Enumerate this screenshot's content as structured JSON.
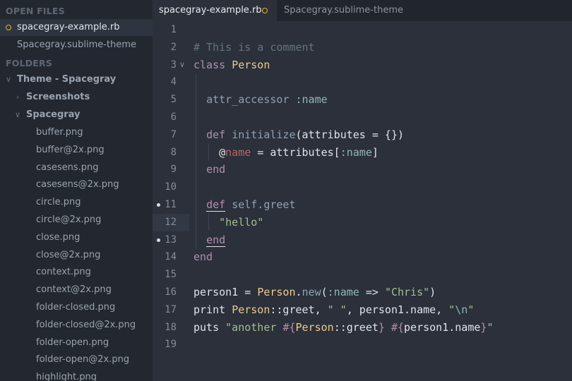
{
  "sidebar": {
    "open_files_header": "OPEN FILES",
    "folders_header": "FOLDERS",
    "open_files": [
      {
        "name": "spacegray-example.rb",
        "modified": true
      },
      {
        "name": "Spacegray.sublime-theme",
        "modified": false
      }
    ],
    "tree": {
      "root": "Theme - Spacegray",
      "screenshots": "Screenshots",
      "spacegray": "Spacegray",
      "files": [
        "buffer.png",
        "buffer@2x.png",
        "casesens.png",
        "casesens@2x.png",
        "circle.png",
        "circle@2x.png",
        "close.png",
        "close@2x.png",
        "context.png",
        "context@2x.png",
        "folder-closed.png",
        "folder-closed@2x.png",
        "folder-open.png",
        "folder-open@2x.png",
        "highlight.png"
      ]
    }
  },
  "tabs": [
    {
      "label": "spacegray-example.rb",
      "active": true,
      "modified": true
    },
    {
      "label": "Spacegray.sublime-theme",
      "active": false,
      "modified": false
    }
  ],
  "editor": {
    "current_line": 12,
    "dirty_lines": [
      11,
      13
    ],
    "fold_line": 3,
    "lines": [
      [],
      [
        [
          "c-comment",
          "# This is a comment"
        ]
      ],
      [
        [
          "c-kw",
          "class"
        ],
        [
          "c-plain",
          " "
        ],
        [
          "c-class",
          "Person"
        ]
      ],
      [],
      [
        [
          "c-plain",
          "  "
        ],
        [
          "c-fn",
          "attr_accessor"
        ],
        [
          "c-plain",
          " "
        ],
        [
          "c-sym",
          ":name"
        ]
      ],
      [],
      [
        [
          "c-plain",
          "  "
        ],
        [
          "c-kw",
          "def"
        ],
        [
          "c-plain",
          " "
        ],
        [
          "c-fn",
          "initialize"
        ],
        [
          "c-plain",
          "(attributes = {})"
        ]
      ],
      [
        [
          "c-plain",
          "    @"
        ],
        [
          "c-ivar",
          "name"
        ],
        [
          "c-plain",
          " = attributes["
        ],
        [
          "c-sym",
          ":name"
        ],
        [
          "c-plain",
          "]"
        ]
      ],
      [
        [
          "c-plain",
          "  "
        ],
        [
          "c-kw",
          "end"
        ]
      ],
      [],
      [
        [
          "c-plain",
          "  "
        ],
        [
          "c-kw uline",
          "def"
        ],
        [
          "c-plain",
          " "
        ],
        [
          "c-fn",
          "self.greet"
        ]
      ],
      [
        [
          "c-plain",
          "    "
        ],
        [
          "c-str",
          "\"hello\""
        ]
      ],
      [
        [
          "c-plain",
          "  "
        ],
        [
          "c-kw uline",
          "end"
        ]
      ],
      [
        [
          "c-kw",
          "end"
        ]
      ],
      [],
      [
        [
          "c-plain",
          "person1 = "
        ],
        [
          "c-class",
          "Person"
        ],
        [
          "c-plain",
          "."
        ],
        [
          "c-fn",
          "new"
        ],
        [
          "c-plain",
          "("
        ],
        [
          "c-sym",
          ":name"
        ],
        [
          "c-plain",
          " => "
        ],
        [
          "c-str",
          "\"Chris\""
        ],
        [
          "c-plain",
          ")"
        ]
      ],
      [
        [
          "c-plain",
          "print "
        ],
        [
          "c-class",
          "Person"
        ],
        [
          "c-plain",
          "::greet, "
        ],
        [
          "c-str",
          "\" \""
        ],
        [
          "c-plain",
          ", person1.name, "
        ],
        [
          "c-str",
          "\""
        ],
        [
          "c-sym",
          "\\n"
        ],
        [
          "c-str",
          "\""
        ]
      ],
      [
        [
          "c-plain",
          "puts "
        ],
        [
          "c-str",
          "\"another "
        ],
        [
          "c-kw",
          "#{"
        ],
        [
          "c-class",
          "Person"
        ],
        [
          "c-plain",
          "::greet"
        ],
        [
          "c-kw",
          "}"
        ],
        [
          "c-str",
          " "
        ],
        [
          "c-kw",
          "#{"
        ],
        [
          "c-plain",
          "person1.name"
        ],
        [
          "c-kw",
          "}"
        ],
        [
          "c-str",
          "\""
        ]
      ],
      []
    ]
  }
}
